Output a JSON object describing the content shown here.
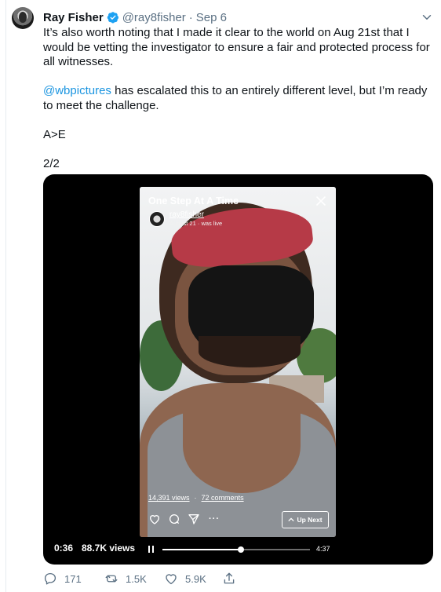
{
  "tweet": {
    "author_name": "Ray Fisher",
    "handle": "@ray8fisher",
    "separator": "·",
    "date": "Sep 6",
    "paragraph1": "It’s also worth noting that I made it clear to the world on Aug 21st that I would be vetting the investigator to ensure a fair and protected process for all witnesses.",
    "mention": "@wbpictures",
    "paragraph2_rest": " has escalated this to an entirely different level, but I’m ready to meet the challenge.",
    "paragraph3": "A>E",
    "paragraph4": "2/2"
  },
  "video": {
    "live_title": "One Step At A Time",
    "live_username": "ray8fisher",
    "live_meta": "August 21 · was live",
    "view_count_link": "14,391 views",
    "dot": "·",
    "comments_link": "72 comments",
    "more": "···",
    "up_next_label": "Up Next",
    "elapsed": "0:36",
    "views": "88.7K views",
    "duration": "4:37",
    "progress_fraction": 0.53
  },
  "actions": {
    "replies": "171",
    "retweets": "1.5K",
    "likes": "5.9K"
  },
  "colors": {
    "link": "#1b95e0",
    "muted": "#5b7083",
    "verified": "#1da1f2"
  }
}
